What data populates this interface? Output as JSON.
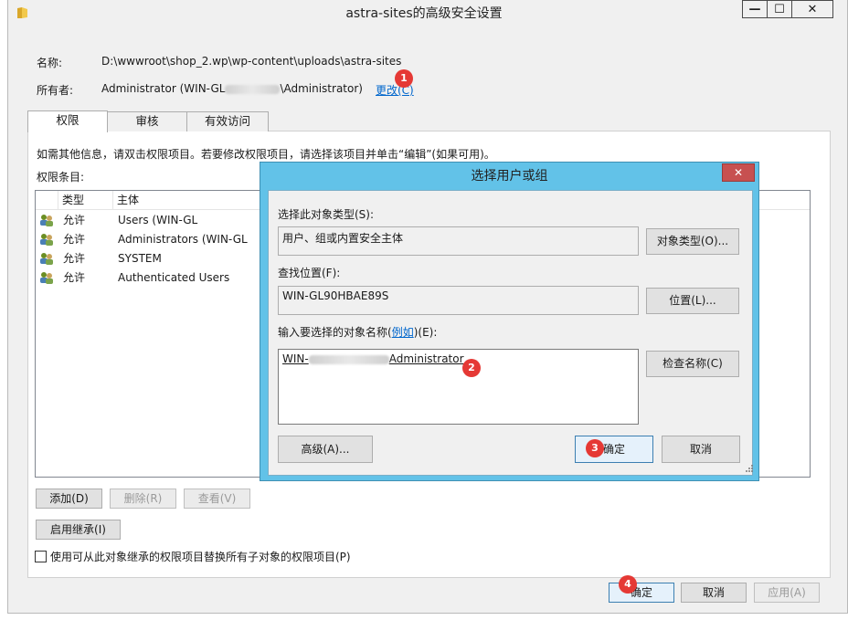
{
  "window": {
    "title": "astra-sites的高级安全设置",
    "controls": {
      "minimize": "—",
      "maximize": "☐",
      "close": "✕"
    }
  },
  "info": {
    "name_label": "名称:",
    "name_value": "D:\\wwwroot\\shop_2.wp\\wp-content\\uploads\\astra-sites",
    "owner_label": "所有者:",
    "owner_value_prefix": "Administrator (WIN-GL",
    "owner_value_suffix": "\\Administrator)",
    "owner_change_link": "更改(C)"
  },
  "tabs": [
    {
      "label": "权限",
      "selected": true
    },
    {
      "label": "审核",
      "selected": false
    },
    {
      "label": "有效访问",
      "selected": false
    }
  ],
  "hint_text": "如需其他信息，请双击权限项目。若要修改权限项目，请选择该项目并单击“编辑”(如果可用)。",
  "list_label": "权限条目:",
  "list": {
    "columns": [
      "类型",
      "主体"
    ],
    "rows": [
      {
        "type": "允许",
        "principal": "Users (WIN-GL",
        "icon": "users-icon"
      },
      {
        "type": "允许",
        "principal": "Administrators (WIN-GL",
        "icon": "users-icon"
      },
      {
        "type": "允许",
        "principal": "SYSTEM",
        "icon": "users-icon"
      },
      {
        "type": "允许",
        "principal": "Authenticated Users",
        "icon": "users-icon"
      }
    ]
  },
  "buttons": {
    "add": "添加(D)",
    "remove": "删除(R)",
    "view": "查看(V)",
    "enable_inheritance": "启用继承(I)",
    "ok": "确定",
    "cancel": "取消",
    "apply": "应用(A)"
  },
  "replace_checkbox": {
    "label": "使用可从此对象继承的权限项目替换所有子对象的权限项目(P)",
    "checked": false
  },
  "dialog": {
    "title": "选择用户或组",
    "object_type_label": "选择此对象类型(S):",
    "object_type_value": "用户、组或内置安全主体",
    "object_type_button": "对象类型(O)...",
    "location_label": "查找位置(F):",
    "location_value": "WIN-GL90HBAE89S",
    "location_button": "位置(L)...",
    "names_label": "输入要选择的对象名称(",
    "names_label_link": "例如",
    "names_label_suffix": ")(E):",
    "names_value_prefix": "WIN-",
    "names_value_suffix": "Administrator",
    "check_names_button": "检查名称(C)",
    "advanced_button": "高级(A)...",
    "ok_button": "确定",
    "cancel_button": "取消"
  },
  "badges": [
    "1",
    "2",
    "3",
    "4"
  ],
  "colors": {
    "dialog_frame": "#62c2e8",
    "close_red": "#c75050",
    "badge_red": "#e53935",
    "link": "#0066cc"
  }
}
